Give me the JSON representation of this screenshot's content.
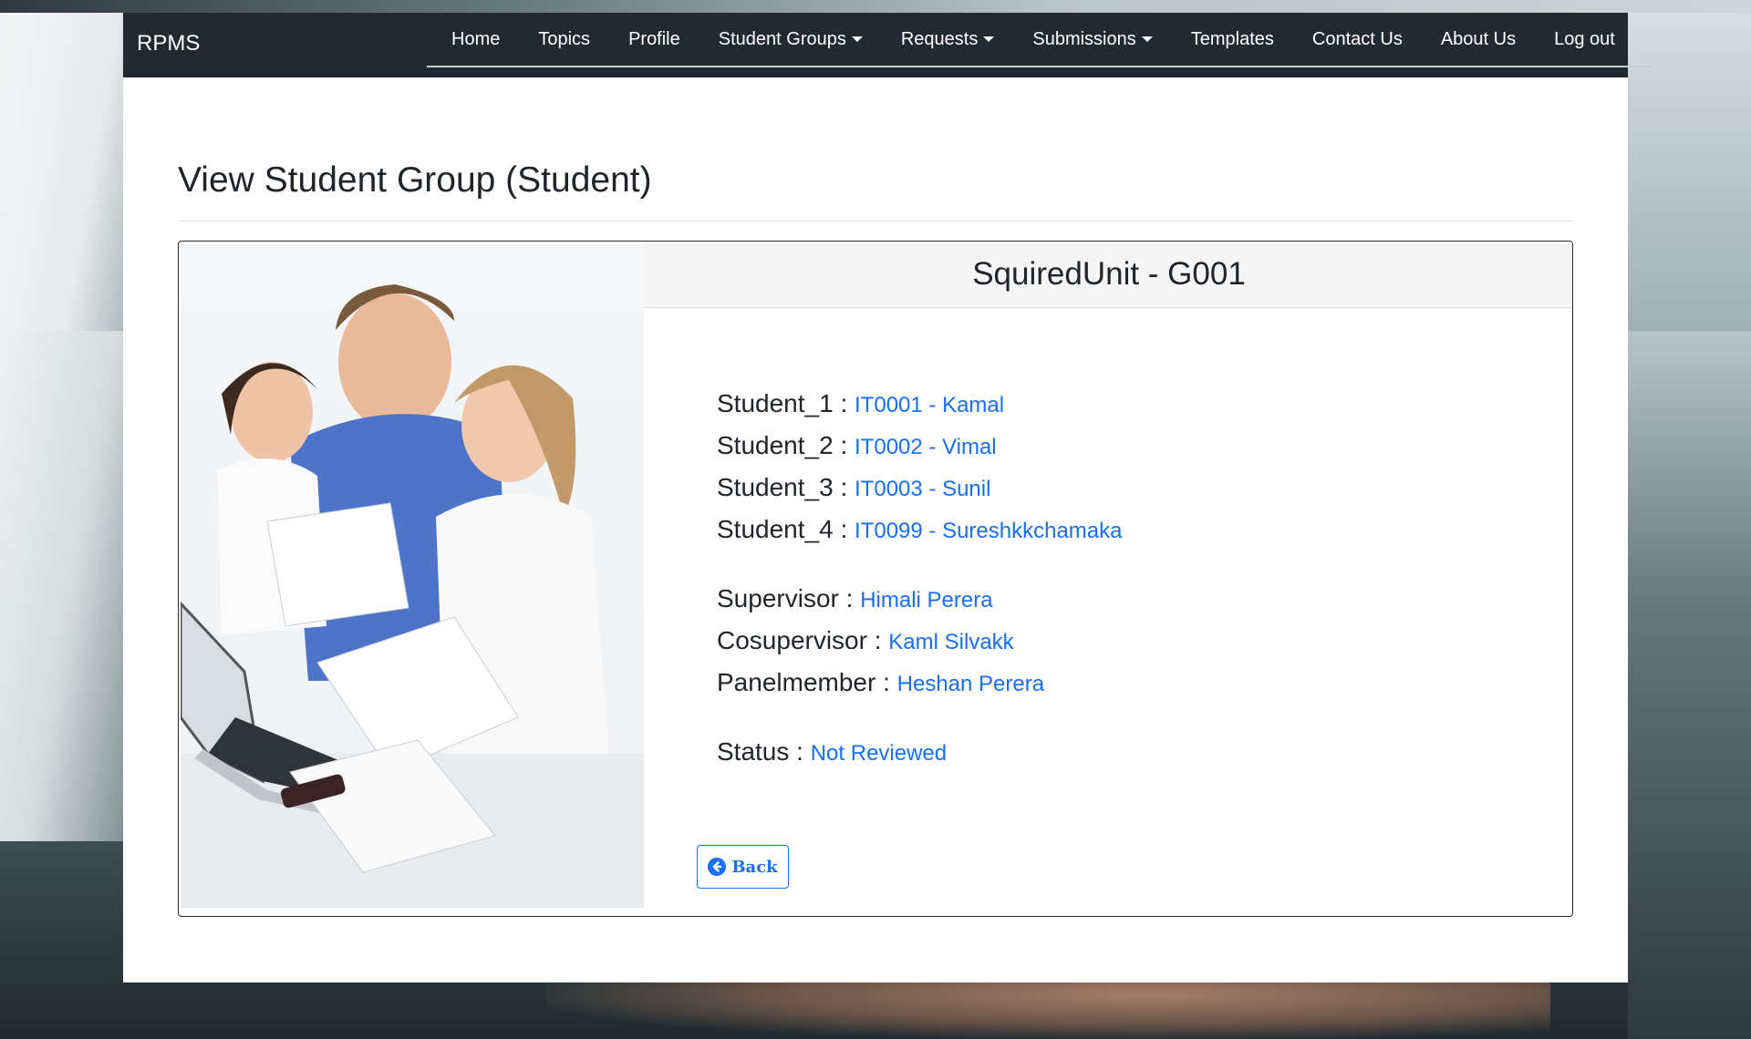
{
  "navbar": {
    "brand": "RPMS",
    "items": [
      {
        "label": "Home",
        "dropdown": false
      },
      {
        "label": "Topics",
        "dropdown": false
      },
      {
        "label": "Profile",
        "dropdown": false
      },
      {
        "label": "Student Groups",
        "dropdown": true
      },
      {
        "label": "Requests",
        "dropdown": true
      },
      {
        "label": "Submissions",
        "dropdown": true
      },
      {
        "label": "Templates",
        "dropdown": false
      },
      {
        "label": "Contact Us",
        "dropdown": false
      },
      {
        "label": "About Us",
        "dropdown": false
      },
      {
        "label": "Log out",
        "dropdown": false
      }
    ]
  },
  "page": {
    "title": "View Student Group (Student)"
  },
  "group": {
    "header": "SquiredUnit - G001",
    "students": [
      {
        "label": "Student_1 :",
        "value": "IT0001 - Kamal"
      },
      {
        "label": "Student_2 :",
        "value": "IT0002 - Vimal"
      },
      {
        "label": "Student_3 :",
        "value": "IT0003 - Sunil"
      },
      {
        "label": "Student_4 :",
        "value": "IT0099 - Sureshkkchamaka"
      }
    ],
    "staff": [
      {
        "label": "Supervisor :",
        "value": "Himali Perera"
      },
      {
        "label": "Cosupervisor :",
        "value": "Kaml Silvakk"
      },
      {
        "label": "Panelmember :",
        "value": "Heshan Perera"
      }
    ],
    "status": {
      "label": "Status :",
      "value": "Not Reviewed"
    }
  },
  "back_button": {
    "label": "Back",
    "icon": "arrow-circle-left-icon"
  },
  "colors": {
    "navbar": "#212a33",
    "accent": "#1a6ef2",
    "text": "#212529"
  }
}
